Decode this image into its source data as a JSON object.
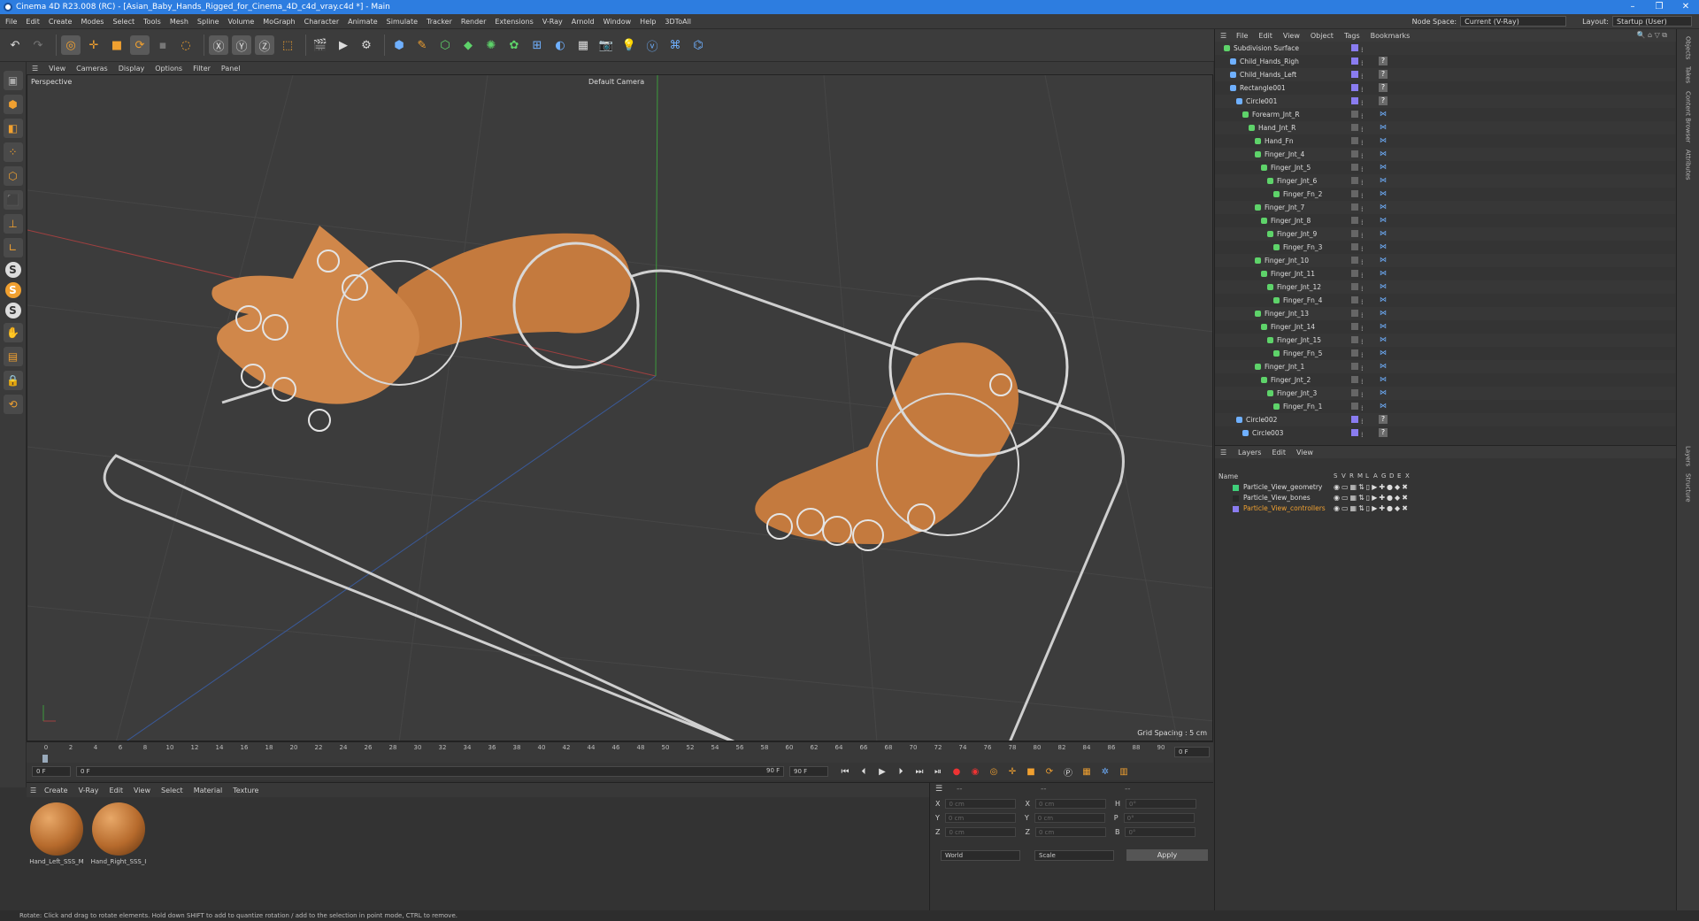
{
  "window": {
    "title": "Cinema 4D R23.008 (RC) - [Asian_Baby_Hands_Rigged_for_Cinema_4D_c4d_vray.c4d *] - Main"
  },
  "menu": [
    "File",
    "Edit",
    "Create",
    "Modes",
    "Select",
    "Tools",
    "Mesh",
    "Spline",
    "Volume",
    "MoGraph",
    "Character",
    "Animate",
    "Simulate",
    "Tracker",
    "Render",
    "Extensions",
    "V-Ray",
    "Arnold",
    "Window",
    "Help",
    "3DToAll"
  ],
  "node_space": {
    "label": "Node Space:",
    "value": "Current (V-Ray)"
  },
  "layout": {
    "label": "Layout:",
    "value": "Startup (User)"
  },
  "viewport": {
    "menu": [
      "View",
      "Cameras",
      "Display",
      "Options",
      "Filter",
      "Panel"
    ],
    "perspective": "Perspective",
    "camera": "Default Camera",
    "grid_spacing": "Grid Spacing : 5 cm"
  },
  "timeline": {
    "ticks": [
      "0",
      "2",
      "4",
      "6",
      "8",
      "10",
      "12",
      "14",
      "16",
      "18",
      "20",
      "22",
      "24",
      "26",
      "28",
      "30",
      "32",
      "34",
      "36",
      "38",
      "40",
      "42",
      "44",
      "46",
      "48",
      "50",
      "52",
      "54",
      "56",
      "58",
      "60",
      "62",
      "64",
      "66",
      "68",
      "70",
      "72",
      "74",
      "76",
      "78",
      "80",
      "82",
      "84",
      "86",
      "88",
      "90"
    ],
    "end_field": "0 F",
    "start": "0 F",
    "current": "0 F",
    "max": "90 F",
    "max2": "90 F"
  },
  "material_panel": {
    "menu": [
      "Create",
      "V-Ray",
      "Edit",
      "View",
      "Select",
      "Material",
      "Texture"
    ],
    "materials": [
      "Hand_Left_SSS_M",
      "Hand_Right_SSS_I"
    ]
  },
  "coords": {
    "rows": [
      {
        "a": "X",
        "av": "0 cm",
        "b": "X",
        "bv": "0 cm",
        "c": "H",
        "cv": "0°"
      },
      {
        "a": "Y",
        "av": "0 cm",
        "b": "Y",
        "bv": "0 cm",
        "c": "P",
        "cv": "0°"
      },
      {
        "a": "Z",
        "av": "0 cm",
        "b": "Z",
        "bv": "0 cm",
        "c": "B",
        "cv": "0°"
      }
    ],
    "world": "World",
    "scale": "Scale",
    "apply": "Apply"
  },
  "object_manager": {
    "menu": [
      "File",
      "Edit",
      "View",
      "Object",
      "Tags",
      "Bookmarks"
    ],
    "items": [
      {
        "name": "Subdivision Surface",
        "depth": 0,
        "color": "#5ed36a"
      },
      {
        "name": "Child_Hands_Righ",
        "depth": 1,
        "color": "#6fb0ff"
      },
      {
        "name": "Child_Hands_Left",
        "depth": 1,
        "color": "#6fb0ff"
      },
      {
        "name": "Rectangle001",
        "depth": 1,
        "color": "#6fb0ff"
      },
      {
        "name": "Circle001",
        "depth": 2,
        "color": "#6fb0ff"
      },
      {
        "name": "Forearm_Jnt_R",
        "depth": 3,
        "color": "#5ed36a"
      },
      {
        "name": "Hand_Jnt_R",
        "depth": 4,
        "color": "#5ed36a"
      },
      {
        "name": "Hand_Fn",
        "depth": 5,
        "color": "#5ed36a"
      },
      {
        "name": "Finger_Jnt_4",
        "depth": 5,
        "color": "#5ed36a"
      },
      {
        "name": "Finger_Jnt_5",
        "depth": 6,
        "color": "#5ed36a"
      },
      {
        "name": "Finger_Jnt_6",
        "depth": 7,
        "color": "#5ed36a"
      },
      {
        "name": "Finger_Fn_2",
        "depth": 8,
        "color": "#5ed36a"
      },
      {
        "name": "Finger_Jnt_7",
        "depth": 5,
        "color": "#5ed36a"
      },
      {
        "name": "Finger_Jnt_8",
        "depth": 6,
        "color": "#5ed36a"
      },
      {
        "name": "Finger_Jnt_9",
        "depth": 7,
        "color": "#5ed36a"
      },
      {
        "name": "Finger_Fn_3",
        "depth": 8,
        "color": "#5ed36a"
      },
      {
        "name": "Finger_Jnt_10",
        "depth": 5,
        "color": "#5ed36a"
      },
      {
        "name": "Finger_Jnt_11",
        "depth": 6,
        "color": "#5ed36a"
      },
      {
        "name": "Finger_Jnt_12",
        "depth": 7,
        "color": "#5ed36a"
      },
      {
        "name": "Finger_Fn_4",
        "depth": 8,
        "color": "#5ed36a"
      },
      {
        "name": "Finger_Jnt_13",
        "depth": 5,
        "color": "#5ed36a"
      },
      {
        "name": "Finger_Jnt_14",
        "depth": 6,
        "color": "#5ed36a"
      },
      {
        "name": "Finger_Jnt_15",
        "depth": 7,
        "color": "#5ed36a"
      },
      {
        "name": "Finger_Fn_5",
        "depth": 8,
        "color": "#5ed36a"
      },
      {
        "name": "Finger_Jnt_1",
        "depth": 5,
        "color": "#5ed36a"
      },
      {
        "name": "Finger_Jnt_2",
        "depth": 6,
        "color": "#5ed36a"
      },
      {
        "name": "Finger_Jnt_3",
        "depth": 7,
        "color": "#5ed36a"
      },
      {
        "name": "Finger_Fn_1",
        "depth": 8,
        "color": "#5ed36a"
      },
      {
        "name": "Circle002",
        "depth": 2,
        "color": "#6fb0ff"
      },
      {
        "name": "Circle003",
        "depth": 3,
        "color": "#6fb0ff"
      }
    ]
  },
  "layer_manager": {
    "menu": [
      "Layers",
      "Edit",
      "View"
    ],
    "name_header": "Name",
    "col_headers": [
      "S",
      "V",
      "R",
      "M",
      "L",
      "A",
      "G",
      "D",
      "E",
      "X"
    ],
    "layers": [
      {
        "name": "Particle_View_geometry",
        "color": "#3fcf7a",
        "text_color": "#dddddd"
      },
      {
        "name": "Particle_View_bones",
        "color": "#2a2a2a",
        "text_color": "#dddddd"
      },
      {
        "name": "Particle_View_controllers",
        "color": "#8a7cf0",
        "text_color": "#f0a030"
      }
    ]
  },
  "right_tabs": [
    "Objects",
    "Takes",
    "Content Browser",
    "Attributes",
    "Layers",
    "Structure"
  ],
  "status": "Rotate: Click and drag to rotate elements. Hold down SHIFT to add to quantize rotation / add to the selection in point mode, CTRL to remove."
}
